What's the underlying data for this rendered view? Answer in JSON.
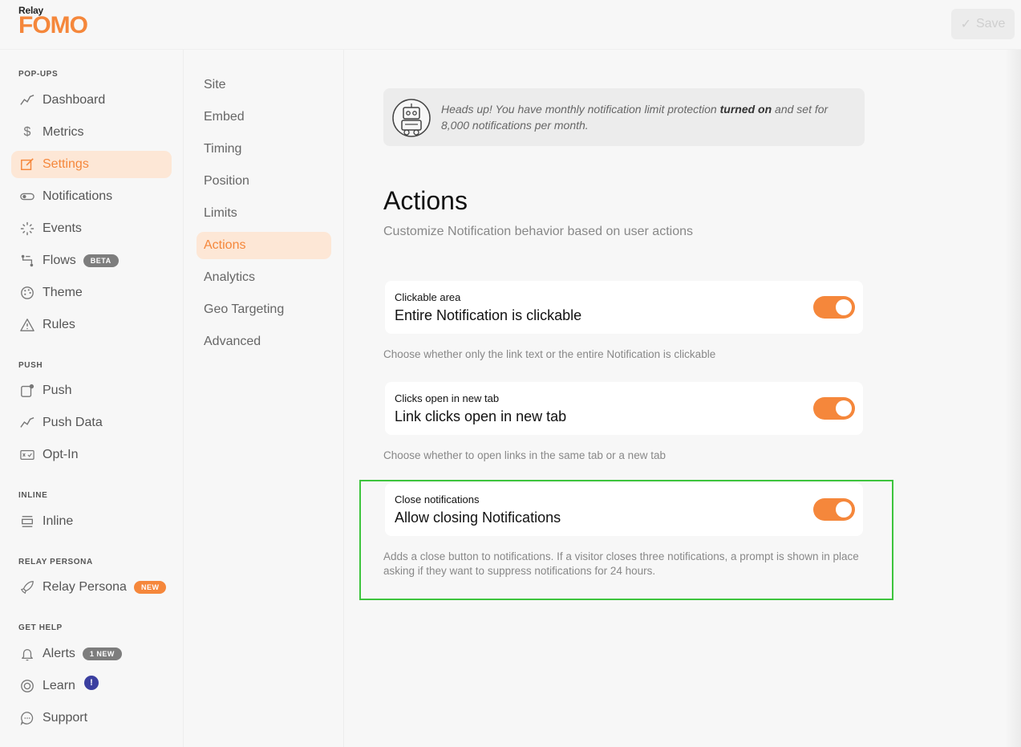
{
  "brand": {
    "small": "Relay",
    "large": "FOMO"
  },
  "toolbar": {
    "save_label": "Save"
  },
  "sidebar": {
    "sections": [
      {
        "title": "POP-UPS"
      },
      {
        "title": "PUSH"
      },
      {
        "title": "INLINE"
      },
      {
        "title": "RELAY PERSONA"
      },
      {
        "title": "GET HELP"
      }
    ],
    "items": [
      {
        "label": "Dashboard",
        "icon": "chart-line-icon"
      },
      {
        "label": "Metrics",
        "icon": "dollar-icon"
      },
      {
        "label": "Settings",
        "icon": "edit-icon",
        "active": true
      },
      {
        "label": "Notifications",
        "icon": "toggle-icon"
      },
      {
        "label": "Events",
        "icon": "spinner-icon"
      },
      {
        "label": "Flows",
        "icon": "flow-icon",
        "badge": "BETA"
      },
      {
        "label": "Theme",
        "icon": "palette-icon"
      },
      {
        "label": "Rules",
        "icon": "warning-icon"
      },
      {
        "label": "Push",
        "icon": "push-icon"
      },
      {
        "label": "Push Data",
        "icon": "chart-line-icon"
      },
      {
        "label": "Opt-In",
        "icon": "opt-in-icon"
      },
      {
        "label": "Inline",
        "icon": "inline-icon"
      },
      {
        "label": "Relay Persona",
        "icon": "rocket-icon",
        "badge": "NEW"
      },
      {
        "label": "Alerts",
        "icon": "bell-icon",
        "badge": "1 NEW"
      },
      {
        "label": "Learn",
        "icon": "lifebuoy-icon",
        "badge": "!"
      },
      {
        "label": "Support",
        "icon": "chat-icon"
      }
    ]
  },
  "subnav": {
    "items": [
      "Site",
      "Embed",
      "Timing",
      "Position",
      "Limits",
      "Actions",
      "Analytics",
      "Geo Targeting",
      "Advanced"
    ],
    "active": "Actions"
  },
  "notice": {
    "text_before": "Heads up! You have monthly notification limit protection ",
    "text_bold": "turned on",
    "text_after": " and set for 8,000 notifications per month."
  },
  "page": {
    "title": "Actions",
    "subtitle": "Customize Notification behavior based on user actions"
  },
  "settings": [
    {
      "label": "Clickable area",
      "value": "Entire Notification is clickable",
      "help": "Choose whether only the link text or the entire Notification is clickable",
      "enabled": true
    },
    {
      "label": "Clicks open in new tab",
      "value": "Link clicks open in new tab",
      "help": "Choose whether to open links in the same tab or a new tab",
      "enabled": true
    },
    {
      "label": "Close notifications",
      "value": "Allow closing Notifications",
      "help": "Adds a close button to notifications. If a visitor closes three notifications, a prompt is shown in place asking if they want to suppress notifications for 24 hours.",
      "enabled": true
    }
  ],
  "colors": {
    "accent": "#f5873b",
    "accent_soft": "#fde7d6",
    "highlight": "#3dc43d",
    "learn_badge": "#3b3fa0"
  }
}
